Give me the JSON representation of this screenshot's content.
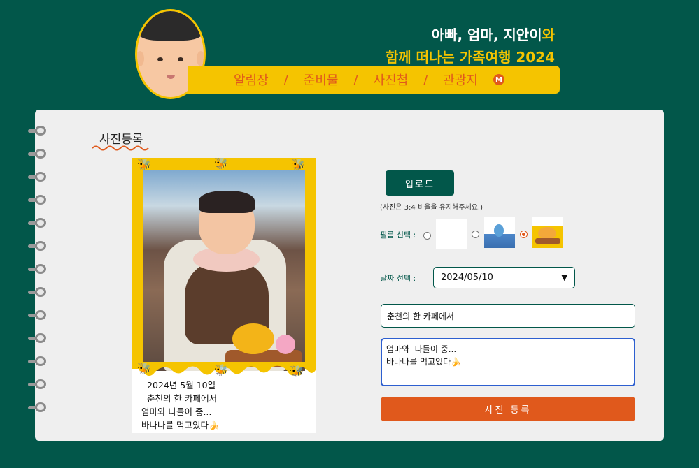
{
  "header": {
    "title_line1_main": "아빠, 엄마, 지안이",
    "title_line1_accent": "와",
    "title_line2": "함께 떠나는 가족여행 2024",
    "nav": {
      "items": [
        "알림장",
        "준비물",
        "사진첩",
        "관광지"
      ],
      "separator": "/",
      "badge_icon": "m-circle-icon",
      "badge_letter": "M"
    }
  },
  "section": {
    "title": "사진등록"
  },
  "card": {
    "caption": {
      "date": "2024년 5월 10일",
      "place": "춘천의 한 카페에서",
      "memo_line1": "엄마와 나들이 중...",
      "memo_line2": "바나나를 먹고있다🍌"
    },
    "bee_icon": "🐝"
  },
  "form": {
    "upload_label": "업로드",
    "hint": "(사진은 3:4 비율을 유지해주세요.)",
    "film_label": "필름 선택 :",
    "film_options": [
      "white-film",
      "blue-eeyore-film",
      "yellow-pooh-film"
    ],
    "film_selected": "yellow-pooh-film",
    "date_label": "날짜 선택 :",
    "date_value": "2024/05/10",
    "place_value": "춘천의 한 카페에서",
    "memo_value": "엄마와  나들이 중...\n바나나를 먹고있다🍌",
    "submit_label": "사진 등록"
  },
  "colors": {
    "background": "#02574a",
    "accent_yellow": "#f5c400",
    "accent_orange": "#e0591c",
    "panel": "#efefef"
  }
}
